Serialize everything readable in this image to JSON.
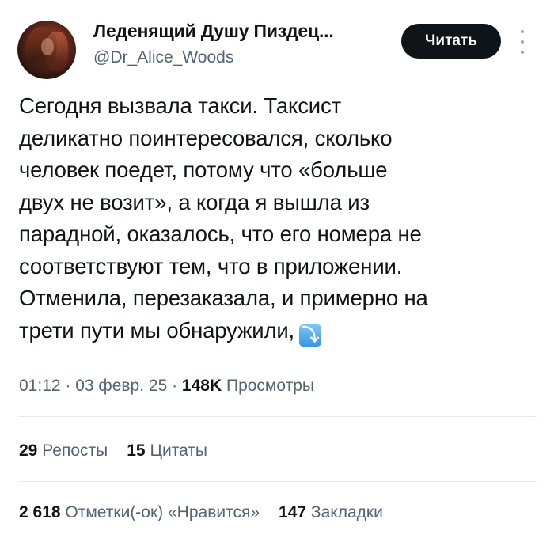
{
  "author": {
    "display_name": "Леденящий Душу Пиздец...",
    "handle": "@Dr_Alice_Woods",
    "avatar_icon": "avatar-photo"
  },
  "actions": {
    "read_label": "Читать",
    "more_icon": "more-vertical-icon"
  },
  "tweet": {
    "text": "Сегодня вызвала такси. Таксист\nделикатно поинтересовался, сколько\nчеловек поедет, потому что «больше\nдвух не возит», а когда я вышла из\nпарадной, оказалось, что его номера не\nсоответствуют тем, что в приложении.\nОтменила, перезаказала, и примерно на\nтрети пути мы обнаружили,",
    "emoji": "⤵"
  },
  "meta": {
    "time": "01:12",
    "separator": " · ",
    "date": "03 февр. 25",
    "views_count": "148K",
    "views_label": "Просмотры"
  },
  "stats": {
    "reposts_count": "29",
    "reposts_label": "Репосты",
    "quotes_count": "15",
    "quotes_label": "Цитаты",
    "likes_count": "2 618",
    "likes_label": "Отметки(-ок) «Нравится»",
    "bookmarks_count": "147",
    "bookmarks_label": "Закладки"
  },
  "colors": {
    "text_primary": "#0f1419",
    "text_secondary": "#536471",
    "button_bg": "#0f1419",
    "divider": "#e6e9eb"
  }
}
